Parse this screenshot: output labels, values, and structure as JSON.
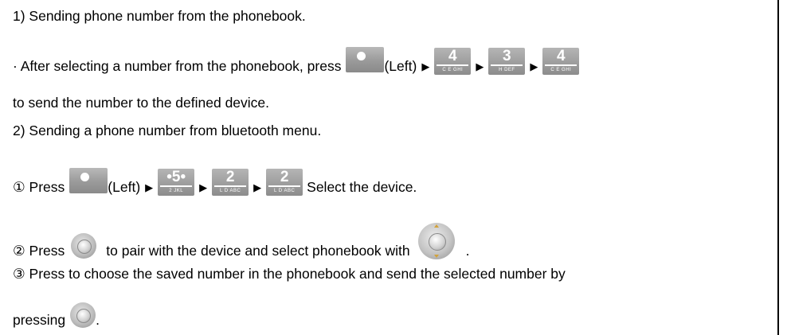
{
  "section1": {
    "heading": "1) Sending phone number from the phonebook.",
    "bullet_text": "· After selecting a number from the phonebook, press",
    "left_label": "(Left)",
    "arrow": "▶",
    "continuation": "to send the number to the defined device."
  },
  "section2": {
    "heading": "2) Sending a phone number from bluetooth menu.",
    "step1_prefix": "① Press",
    "step1_left_label": "(Left)",
    "step1_suffix": "Select the device.",
    "step2_prefix": "② Press",
    "step2_middle": "to pair with the device and select phonebook with",
    "step2_end": ".",
    "step3_text": "③ Press to choose the saved number in the phonebook and send the selected number by",
    "step3_cont": "pressing",
    "step3_end": "."
  },
  "keys": {
    "k4": {
      "digit": "4",
      "letters": "C E GHI"
    },
    "k3": {
      "digit": "3",
      "letters": "H DEF"
    },
    "k5": {
      "digit": "•5•",
      "letters": "2 JKL"
    },
    "k2": {
      "digit": "2",
      "letters": "L D ABC"
    }
  },
  "icons": {
    "softkey": "left-softkey-icon",
    "numeric": "numeric-key-icon",
    "ok": "ok-key-icon",
    "nav": "navigation-key-icon"
  },
  "colors": {
    "key_gray": "#9e9e9e",
    "nav_accent": "#d2a23a"
  }
}
